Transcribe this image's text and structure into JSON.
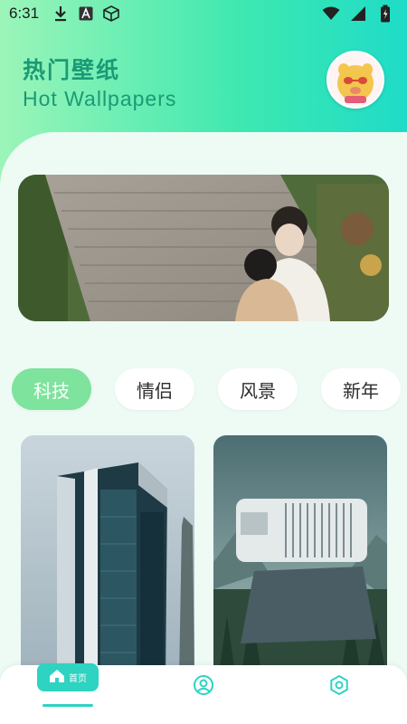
{
  "status_bar": {
    "time": "6:31",
    "left_icons": [
      "download-icon",
      "text-app-icon",
      "cube-icon"
    ],
    "right_icons": [
      "wifi-icon",
      "signal-icon",
      "battery-icon"
    ]
  },
  "header": {
    "title_cn": "热门壁纸",
    "title_en": "Hot Wallpapers"
  },
  "categories": [
    {
      "label": "科技",
      "active": true
    },
    {
      "label": "情侣",
      "active": false
    },
    {
      "label": "风景",
      "active": false
    },
    {
      "label": "新年",
      "active": false
    }
  ],
  "bottom_nav": {
    "home_label": "首页",
    "items": [
      "home-icon",
      "profile-icon",
      "settings-icon"
    ]
  },
  "colors": {
    "accent": "#2ed3c2",
    "title": "#1a9a76",
    "chip_active": "#7ee39c",
    "panel_bg": "#eefbf5"
  }
}
